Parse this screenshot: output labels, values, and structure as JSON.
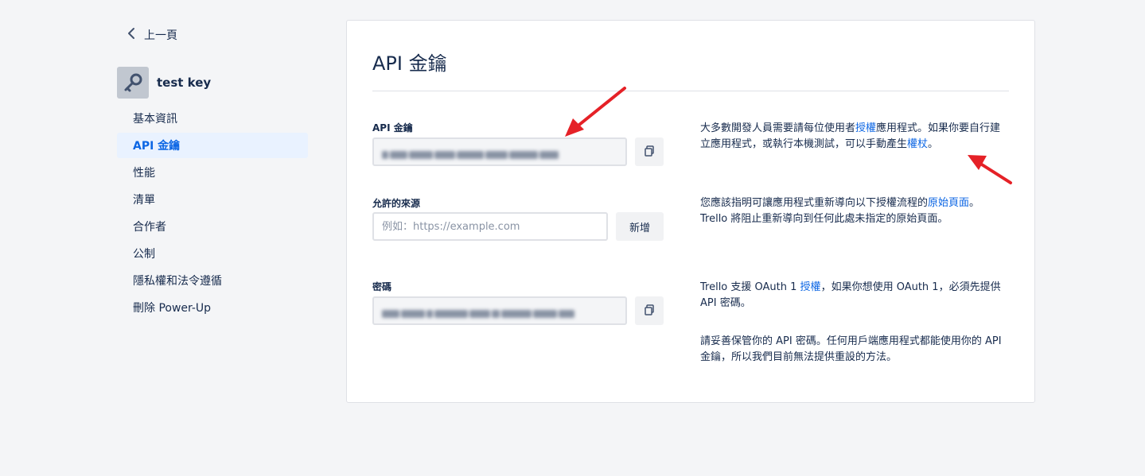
{
  "sidebar": {
    "back_label": "上一頁",
    "app_name": "test key",
    "items": [
      {
        "label": "基本資訊"
      },
      {
        "label": "API 金鑰"
      },
      {
        "label": "性能"
      },
      {
        "label": "清單"
      },
      {
        "label": "合作者"
      },
      {
        "label": "公制"
      },
      {
        "label": "隱私權和法令遵循"
      },
      {
        "label": "刪除 Power-Up"
      }
    ]
  },
  "main": {
    "title": "API 金鑰",
    "api_key": {
      "label": "API 金鑰",
      "help_pre": "大多數開發人員需要請每位使用者",
      "help_link1": "授權",
      "help_mid": "應用程式。如果你要自行建立應用程式，或執行本機測試，可以手動產生",
      "help_link2": "權杖",
      "help_post": "。"
    },
    "allowed_origins": {
      "label": "允許的來源",
      "placeholder": "例如：https://example.com",
      "add_label": "新增",
      "help_pre": "您應該指明可讓應用程式重新導向以下授權流程的",
      "help_link": "原始頁面",
      "help_post": "。Trello 將阻止重新導向到任何此處未指定的原始頁面。"
    },
    "secret": {
      "label": "密碼",
      "help1_pre": "Trello 支援 OAuth 1 ",
      "help1_link": "授權",
      "help1_post": "，如果你想使用 OAuth 1，必須先提供 API 密碼。",
      "help2": "請妥善保管你的 API 密碼。任何用戶端應用程式都能使用你的 API 金鑰，所以我們目前無法提供重設的方法。"
    }
  },
  "colors": {
    "accent": "#0c66e4",
    "active_bg": "#e9f2ff",
    "arrow": "#e52127"
  }
}
